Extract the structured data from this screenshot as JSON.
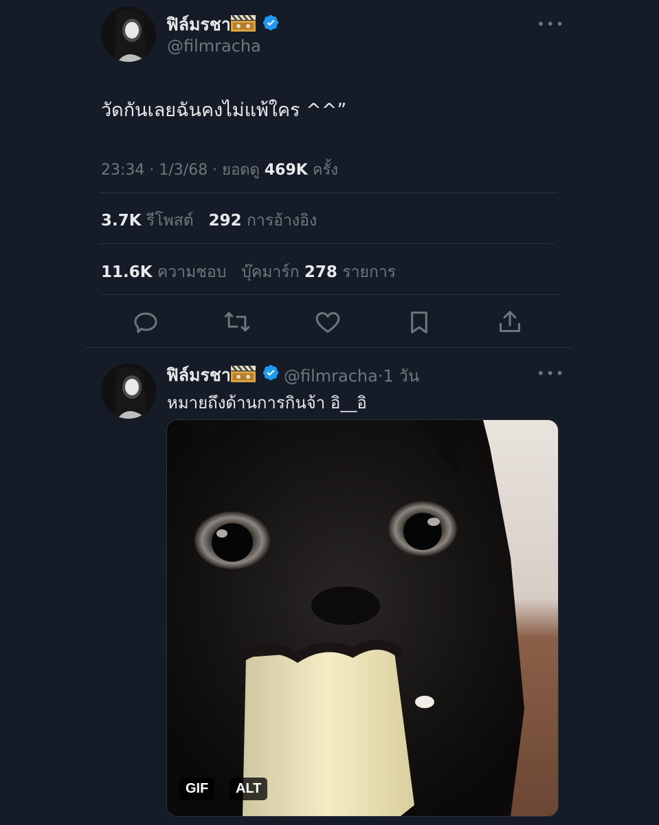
{
  "main_tweet": {
    "display_name": "ฟิล์มรชา",
    "handle": "@filmracha",
    "text": "วัดกันเลยฉันคงไม่แพ้ใคร ^^”",
    "timestamp": "23:34 · 1/3/68 · ยอดดู",
    "views_count": "469K",
    "views_suffix": "ครั้ง",
    "reposts_count": "3.7K",
    "reposts_label": "รีโพสต์",
    "quotes_count": "292",
    "quotes_label": "การอ้างอิง",
    "likes_count": "11.6K",
    "likes_label": "ความชอบ",
    "bookmarks_prefix": "บุ๊คมาร์ก",
    "bookmarks_count": "278",
    "bookmarks_suffix": "รายการ",
    "actions": [
      "reply-icon",
      "repost-icon",
      "like-icon",
      "bookmark-icon",
      "share-icon"
    ]
  },
  "reply_tweet": {
    "display_name": "ฟิล์มรชา",
    "handle": "@filmracha",
    "time_sep": "·",
    "time": "1 วัน",
    "text": "หมายถึงด้านการกินจ้า อิ__อิ",
    "media_badges": {
      "gif": "GIF",
      "alt": "ALT"
    }
  },
  "colors": {
    "background": "#151c27",
    "text_primary": "#e7e9ea",
    "text_secondary": "#71767b",
    "verified_blue": "#1d9bf0",
    "divider": "#2f3336"
  }
}
